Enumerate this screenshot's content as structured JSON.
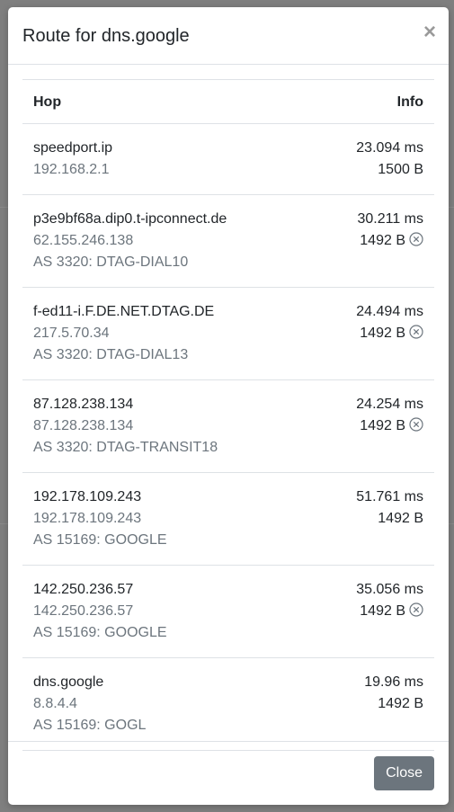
{
  "modal": {
    "title": "Route for dns.google",
    "close_glyph": "×",
    "close_button_label": "Close"
  },
  "table": {
    "headers": {
      "hop": "Hop",
      "info": "Info"
    },
    "rows": [
      {
        "host": "speedport.ip",
        "ip": "192.168.2.1",
        "as": "",
        "latency": "23.094 ms",
        "mtu": "1500 B",
        "mtu_icon": false
      },
      {
        "host": "p3e9bf68a.dip0.t-ipconnect.de",
        "ip": "62.155.246.138",
        "as": "AS 3320: DTAG-DIAL10",
        "latency": "30.211 ms",
        "mtu": "1492 B",
        "mtu_icon": true
      },
      {
        "host": "f-ed11-i.F.DE.NET.DTAG.DE",
        "ip": "217.5.70.34",
        "as": "AS 3320: DTAG-DIAL13",
        "latency": "24.494 ms",
        "mtu": "1492 B",
        "mtu_icon": true
      },
      {
        "host": "87.128.238.134",
        "ip": "87.128.238.134",
        "as": "AS 3320: DTAG-TRANSIT18",
        "latency": "24.254 ms",
        "mtu": "1492 B",
        "mtu_icon": true
      },
      {
        "host": "192.178.109.243",
        "ip": "192.178.109.243",
        "as": "AS 15169: GOOGLE",
        "latency": "51.761 ms",
        "mtu": "1492 B",
        "mtu_icon": false
      },
      {
        "host": "142.250.236.57",
        "ip": "142.250.236.57",
        "as": "AS 15169: GOOGLE",
        "latency": "35.056 ms",
        "mtu": "1492 B",
        "mtu_icon": true
      },
      {
        "host": "dns.google",
        "ip": "8.8.4.4",
        "as": "AS 15169: GOGL",
        "latency": "19.96 ms",
        "mtu": "1492 B",
        "mtu_icon": false
      }
    ]
  },
  "icons": {
    "mtu_changed": "circle-x-icon"
  },
  "colors": {
    "muted_text": "#6c757d",
    "close_button_bg": "#6c757d",
    "border": "#dee2e6"
  }
}
